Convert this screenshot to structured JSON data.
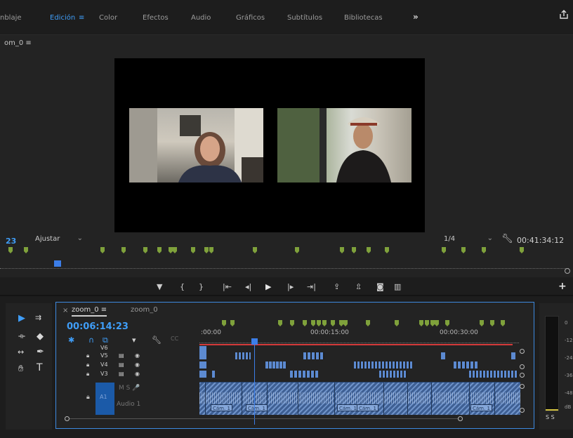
{
  "workspace_tabs": [
    {
      "label": "nblaje",
      "active": false
    },
    {
      "label": "Edición",
      "active": true
    },
    {
      "label": "Color",
      "active": false
    },
    {
      "label": "Efectos",
      "active": false
    },
    {
      "label": "Audio",
      "active": false
    },
    {
      "label": "Gráficos",
      "active": false
    },
    {
      "label": "Subtítulos",
      "active": false
    },
    {
      "label": "Bibliotecas",
      "active": false
    }
  ],
  "workspace_more": "»",
  "edit_menu_icon": "≡",
  "monitor": {
    "title": "om_0  ≡",
    "timecode_left": "23",
    "fit_label": "Ajustar",
    "resolution_label": "1/4",
    "timecode_right": "00:41:34:12"
  },
  "transport_icons": [
    "marker-icon",
    "in-point-icon",
    "out-point-icon",
    "go-to-in-icon",
    "step-back-icon",
    "play-icon",
    "step-forward-icon",
    "go-to-out-icon",
    "lift-icon",
    "extract-icon",
    "camera-icon",
    "compare-icon"
  ],
  "transport_glyphs": [
    "▼",
    "{",
    "}",
    "|⇤",
    "◂|",
    "▶",
    "|▸",
    "⇥|",
    "⇪",
    "⇫",
    "◙",
    "▥"
  ],
  "add_label": "+",
  "timeline": {
    "close": "×",
    "tab_active": "zoom_0  ≡",
    "tab_other": "zoom_0",
    "timecode": "00:06:14:23",
    "ruler": [
      ":00:00",
      "00:00:15:00",
      "00:00:30:00"
    ],
    "video_tracks": [
      {
        "name": "V6",
        "partial": true
      },
      {
        "name": "V5"
      },
      {
        "name": "V4"
      },
      {
        "name": "V3"
      }
    ],
    "audio_track": {
      "name": "A1",
      "label": "Audio 1",
      "controls": "M  S  🎤"
    },
    "cam_labels": [
      "Cám. 1",
      "Cám. 1",
      "Cám. 1",
      "Cám. 1",
      "Cám. 1"
    ]
  },
  "meters": {
    "db_labels": [
      "0",
      "-12",
      "-24",
      "-36",
      "-48",
      "dB"
    ],
    "solo": "S  S"
  },
  "colors": {
    "accent": "#3f9df7",
    "marker": "#7fa13b",
    "work_area": "#d43a3a",
    "audio": "#5c8ad1"
  }
}
